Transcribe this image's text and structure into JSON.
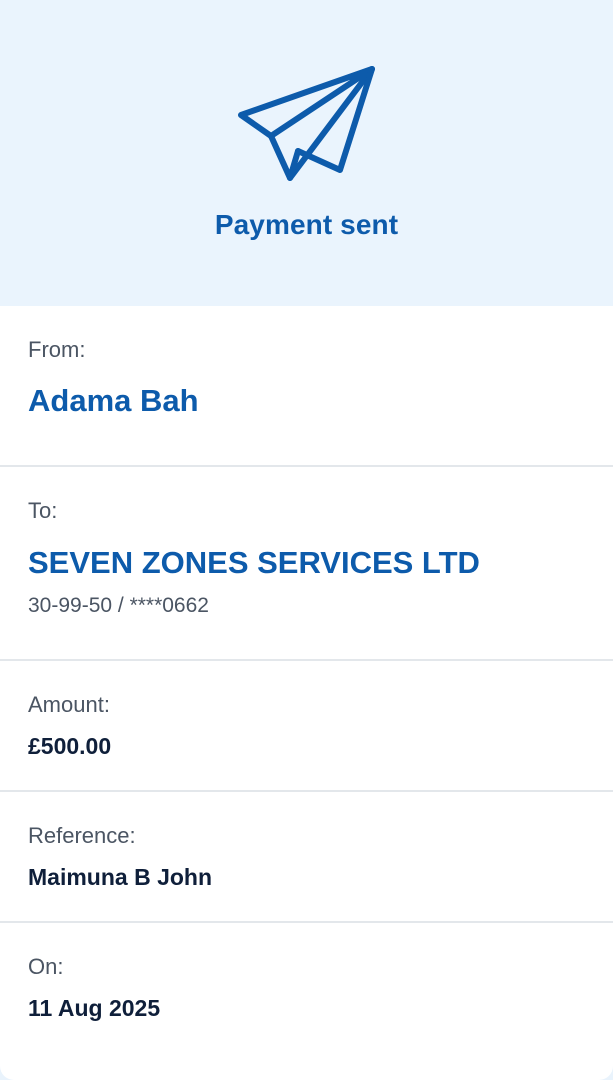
{
  "header": {
    "icon": "paper-plane-icon",
    "title": "Payment sent",
    "accent_color": "#0d5bab",
    "background_color": "#eaf4fd"
  },
  "details": {
    "from": {
      "label": "From:",
      "name": "Adama Bah"
    },
    "to": {
      "label": "To:",
      "name": "SEVEN ZONES SERVICES LTD",
      "account": "30-99-50 / ****0662"
    },
    "amount": {
      "label": "Amount:",
      "value": "£500.00"
    },
    "reference": {
      "label": "Reference:",
      "value": "Maimuna B John"
    },
    "date": {
      "label": "On:",
      "value": "11 Aug 2025"
    }
  }
}
